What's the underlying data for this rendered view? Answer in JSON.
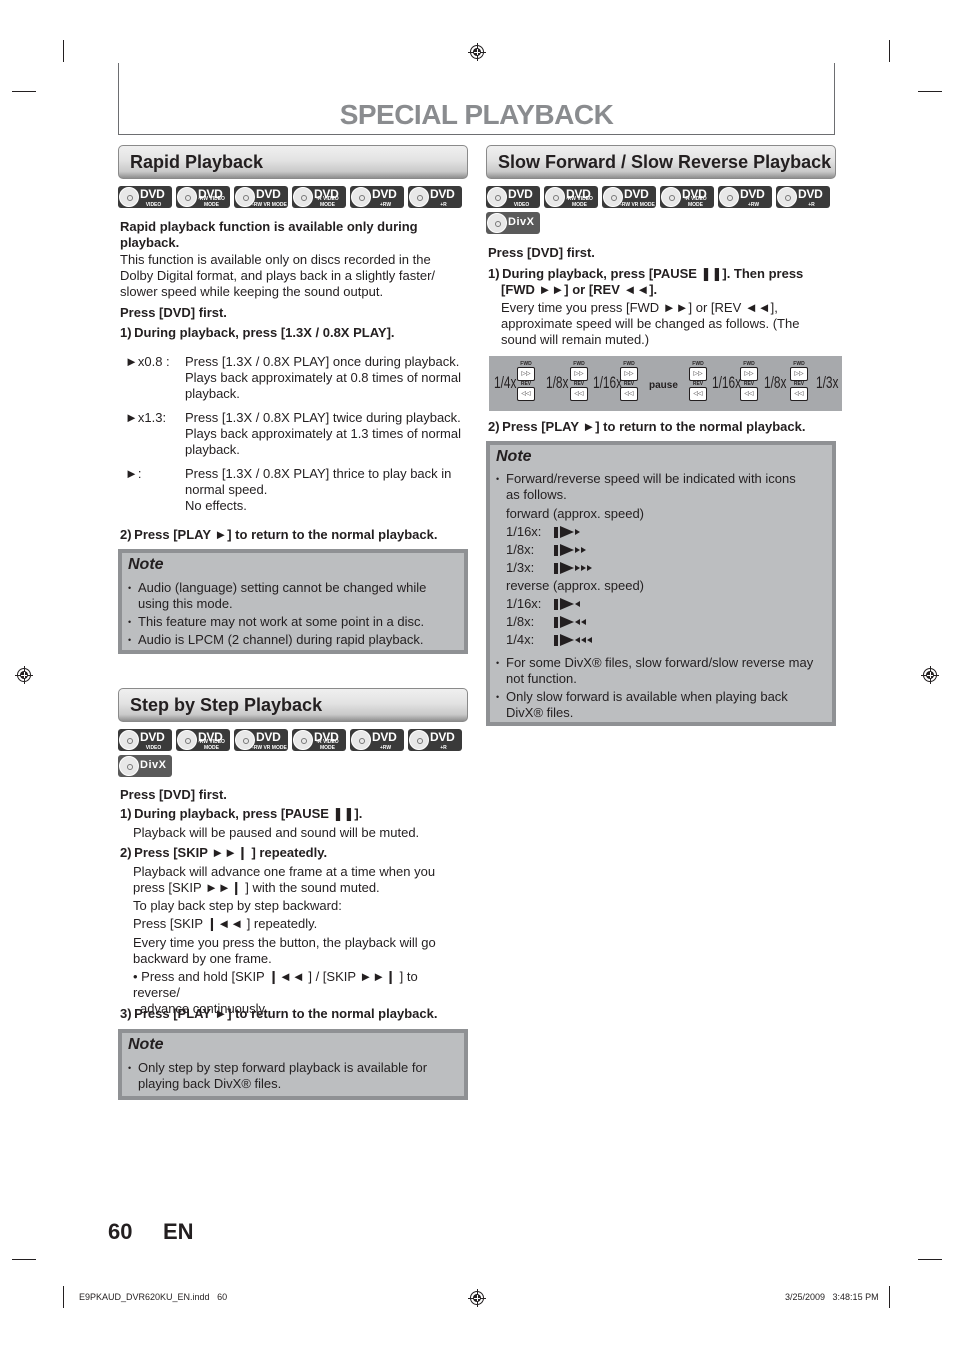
{
  "page_title": "SPECIAL PLAYBACK",
  "disc_badges": [
    {
      "main": "DVD",
      "sub": "VIDEO"
    },
    {
      "main": "DVD",
      "sub": "-RW VIDEO MODE"
    },
    {
      "main": "DVD",
      "sub": "-RW VR MODE"
    },
    {
      "main": "DVD",
      "sub": "-R VIDEO MODE"
    },
    {
      "main": "DVD",
      "sub": "+RW"
    },
    {
      "main": "DVD",
      "sub": "+R"
    }
  ],
  "divx_badge": "DivX",
  "rapid": {
    "heading": "Rapid Playback",
    "bold_intro_1": "Rapid playback function is available only during",
    "bold_intro_2": "playback.",
    "desc_1": "This function is available only on discs recorded in the",
    "desc_2": "Dolby Digital format, and plays back in a slightly faster/",
    "desc_3": "slower speed while keeping the sound output.",
    "press_first": "Press [DVD] first.",
    "step1": "1) During playback, press [1.3X / 0.8X PLAY].",
    "options": [
      {
        "key": "►x0.8 :",
        "lines": [
          "Press [1.3X / 0.8X PLAY] once during playback.",
          "Plays back approximately at 0.8 times of normal",
          "playback."
        ]
      },
      {
        "key": "►x1.3:",
        "lines": [
          "Press [1.3X / 0.8X PLAY] twice during playback.",
          "Plays back approximately at 1.3 times of normal",
          "playback."
        ]
      },
      {
        "key": "►:",
        "lines": [
          "Press [1.3X / 0.8X PLAY] thrice to play back in",
          "normal speed.",
          "No effects."
        ]
      }
    ],
    "step2": "2) Press [PLAY ►] to return to the normal playback.",
    "note": {
      "title": "Note",
      "items": [
        "Audio (language) setting cannot be changed while using this mode.",
        "This feature may not work at some point in a disc.",
        "Audio is LPCM (2 channel) during rapid playback."
      ]
    }
  },
  "step": {
    "heading": "Step by Step Playback",
    "press_first": "Press [DVD] first.",
    "step1": "1) During playback, press [PAUSE ❚❚].",
    "step1_desc": "Playback will be paused and sound will be muted.",
    "step2": "2) Press [SKIP ►►❙ ] repeatedly.",
    "step2_desc_1": "Playback will advance one frame at a time when you",
    "step2_desc_2": "press [SKIP ►►❙ ] with the sound muted.",
    "step2_desc_3": "To play back step by step backward:",
    "step2_desc_4": "Press [SKIP ❙◄◄ ] repeatedly.",
    "step2_desc_5": "Every time you press the button, the playback will go",
    "step2_desc_6": "backward by one frame.",
    "step2_bullet_1": "• Press and hold [SKIP ❙◄◄ ] / [SKIP ►►❙ ] to reverse/",
    "step2_bullet_2": "advance continuously.",
    "step3": "3) Press [PLAY ►] to return to the normal playback.",
    "note": {
      "title": "Note",
      "items": [
        "Only step by step forward playback is available for playing back DivX® files."
      ]
    }
  },
  "slow": {
    "heading": "Slow Forward / Slow Reverse Playback",
    "press_first": "Press [DVD] first.",
    "step1_a": "1) During playback, press [PAUSE ❚❚]. Then press",
    "step1_b": "[FWD ►►] or [REV ◄◄].",
    "step1_desc_1": "Every time you press [FWD ►►] or [REV ◄◄],",
    "step1_desc_2": "approximate speed will be changed as follows. (The",
    "step1_desc_3": "sound will remain muted.)",
    "speed_sequence": [
      "1/4x",
      "1/8x",
      "1/16x",
      "pause",
      "1/16x",
      "1/8x",
      "1/3x"
    ],
    "btn_fwd": "FWD",
    "btn_rev": "REV",
    "step2": "2) Press [PLAY ►] to return to the normal playback.",
    "note": {
      "title": "Note",
      "item1_a": "Forward/reverse speed will be indicated with icons",
      "item1_b": "as follows.",
      "forward_label": "forward (approx. speed)",
      "forward": [
        {
          "label": "1/16x:",
          "arrows": 1
        },
        {
          "label": "1/8x:",
          "arrows": 2
        },
        {
          "label": "1/3x:",
          "arrows": 3
        }
      ],
      "reverse_label": "reverse (approx. speed)",
      "reverse": [
        {
          "label": "1/16x:",
          "arrows": 1
        },
        {
          "label": "1/8x:",
          "arrows": 2
        },
        {
          "label": "1/4x:",
          "arrows": 3
        }
      ],
      "item2": "For some DivX® files, slow forward/slow reverse may not function.",
      "item3": "Only slow forward is available when playing back DivX® files."
    }
  },
  "footer": {
    "page_number": "60",
    "lang": "EN",
    "slug_file": "E9PKAUD_DVR620KU_EN.indd   60",
    "slug_date": "3/25/2009   3:48:15 PM"
  }
}
